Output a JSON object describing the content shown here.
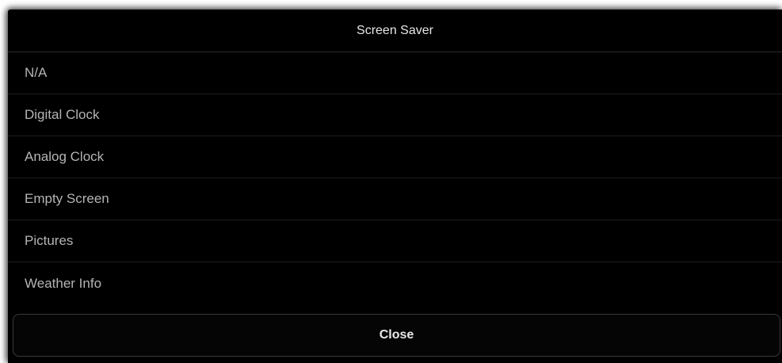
{
  "dialog": {
    "title": "Screen Saver",
    "options": [
      {
        "label": "N/A"
      },
      {
        "label": "Digital Clock"
      },
      {
        "label": "Analog Clock"
      },
      {
        "label": "Empty Screen"
      },
      {
        "label": "Pictures"
      },
      {
        "label": "Weather Info"
      }
    ],
    "close_label": "Close"
  },
  "colors": {
    "background": "#000000",
    "title_text": "#e6e6e6",
    "option_text": "#b4b4b4",
    "divider": "#1e1e1e",
    "button_border": "#3a3a3a"
  }
}
